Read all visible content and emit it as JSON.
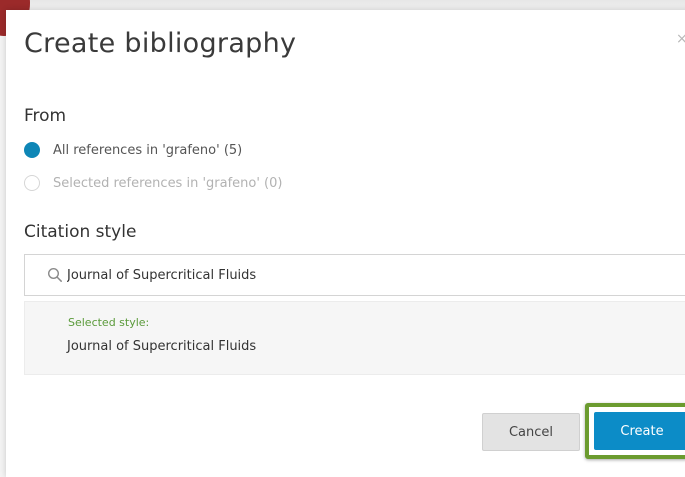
{
  "dialog": {
    "title": "Create bibliography",
    "close_glyph": "×"
  },
  "from": {
    "heading": "From",
    "options": [
      {
        "label": "All references in 'grafeno' (5)",
        "checked": true,
        "enabled": true
      },
      {
        "label": "Selected references in 'grafeno' (0)",
        "checked": false,
        "enabled": false
      }
    ]
  },
  "citation": {
    "heading": "Citation style",
    "search_value": "Journal of Supercritical Fluids",
    "selected_caption": "Selected style:",
    "selected_name": "Journal of Supercritical Fluids"
  },
  "actions": {
    "cancel_label": "Cancel",
    "create_label": "Create"
  },
  "colors": {
    "accent": "#0c8cc7",
    "radio_checked": "#0e86b6",
    "highlight": "#6b9b2f",
    "selected_caption": "#5a9a3a",
    "corner_badge": "#9b2a2a"
  },
  "icons": [
    "close-icon",
    "search-icon",
    "radio-checked-icon",
    "radio-unchecked-icon"
  ]
}
